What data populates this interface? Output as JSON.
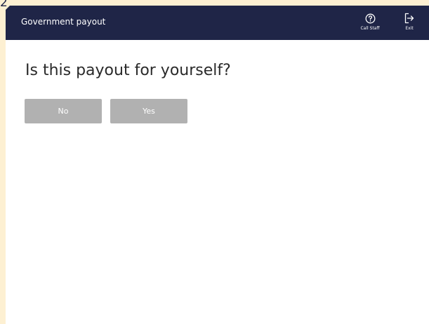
{
  "step": {
    "number": "2"
  },
  "header": {
    "title": "Government payout",
    "call_staff_label": "Call Staff",
    "exit_label": "Exit"
  },
  "main": {
    "question": "Is this payout for yourself?",
    "options": [
      {
        "label": "No"
      },
      {
        "label": "Yes"
      }
    ]
  },
  "icons": {
    "call_staff": "question-circle-icon",
    "exit": "exit-door-icon"
  },
  "colors": {
    "header_bg": "#1f2547",
    "button_bg": "#b1b1b1",
    "frame_border": "#fdf0d2",
    "question_text": "#2a2a2a"
  }
}
